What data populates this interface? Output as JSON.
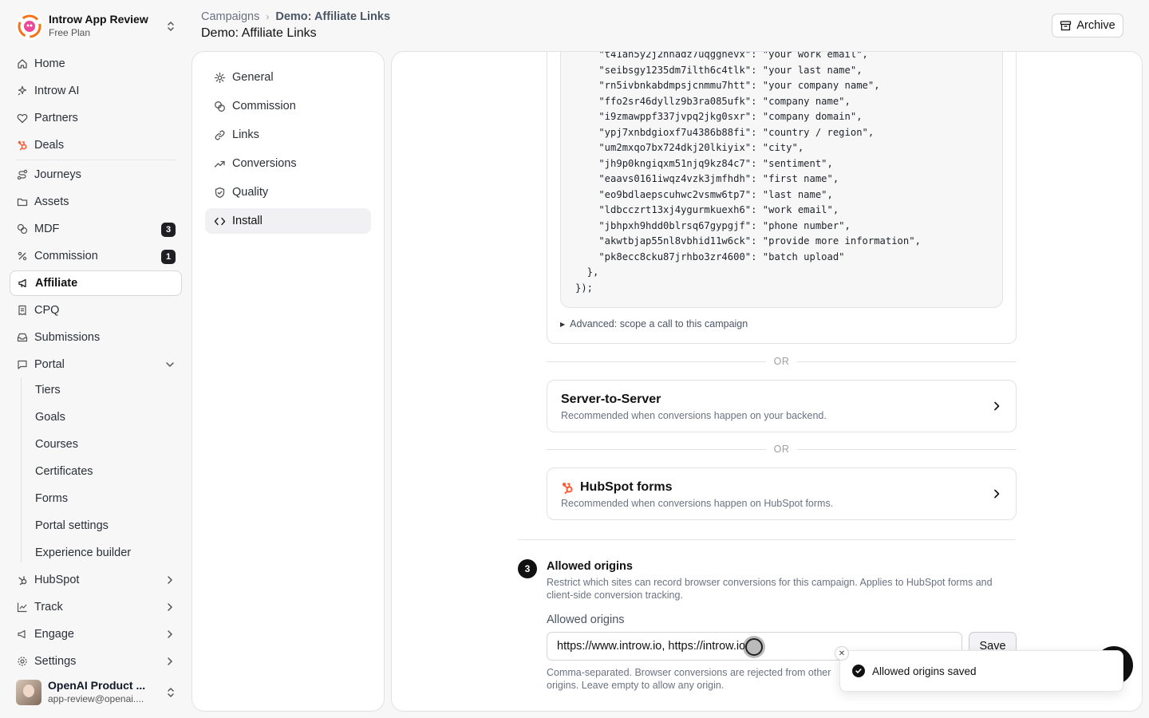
{
  "workspace": {
    "name": "Introw App Review",
    "plan": "Free Plan"
  },
  "nav": {
    "home": "Home",
    "introw_ai": "Introw AI",
    "partners": "Partners",
    "deals": "Deals",
    "journeys": "Journeys",
    "assets": "Assets",
    "mdf": "MDF",
    "mdf_badge": "3",
    "commission": "Commission",
    "commission_badge": "1",
    "affiliate": "Affiliate",
    "cpq": "CPQ",
    "submissions": "Submissions",
    "portal": "Portal",
    "portal_items": [
      "Tiers",
      "Goals",
      "Courses",
      "Certificates",
      "Forms",
      "Portal settings",
      "Experience builder"
    ],
    "hubspot": "HubSpot",
    "track": "Track",
    "engage": "Engage",
    "settings": "Settings"
  },
  "user": {
    "name": "OpenAI Product ...",
    "email": "app-review@openai...."
  },
  "header": {
    "breadcrumb_root": "Campaigns",
    "breadcrumb_current": "Demo: Affiliate Links",
    "title": "Demo: Affiliate Links",
    "archive_label": "Archive"
  },
  "settings_menu": [
    "General",
    "Commission",
    "Links",
    "Conversions",
    "Quality",
    "Install"
  ],
  "code_lines": [
    "    \"t41an5y2j2hnadz7uqgghevx\": \"your work email\",",
    "    \"seibsgy1235dm7ilth6c4tlk\": \"your last name\",",
    "    \"rn5ivbnkabdmpsjcnmmu7htt\": \"your company name\",",
    "    \"ffo2sr46dyllz9b3ra085ufk\": \"company name\",",
    "    \"i9zmawppf337jvpq2jkg0sxr\": \"company domain\",",
    "    \"ypj7xnbdgioxf7u4386b88fi\": \"country / region\",",
    "    \"um2mxqo7bx724dkj20lkiyix\": \"city\",",
    "    \"jh9p0kngiqxm51njq9kz84c7\": \"sentiment\",",
    "    \"eaavs0161iwqz4vzk3jmfhdh\": \"first name\",",
    "    \"eo9bdlaepscuhwc2vsmw6tp7\": \"last name\",",
    "    \"ldbcczrt13xj4ygurmkuexh6\": \"work email\",",
    "    \"jbhpxh9hdd0blrsq67gypgjf\": \"phone number\",",
    "    \"akwtbjap55nl8vbhid11w6ck\": \"provide more information\",",
    "    \"pk8ecc8cku87jrhbo3zr4600\": \"batch upload\"",
    "  },",
    "});"
  ],
  "advanced_label": "Advanced: scope a call to this campaign",
  "or_label": "OR",
  "server_card": {
    "title": "Server-to-Server",
    "desc": "Recommended when conversions happen on your backend."
  },
  "hubspot_card": {
    "title": "HubSpot forms",
    "desc": "Recommended when conversions happen on HubSpot forms."
  },
  "origins_section": {
    "step": "3",
    "title": "Allowed origins",
    "desc": "Restrict which sites can record browser conversions for this campaign. Applies to HubSpot forms and client-side conversion tracking.",
    "field_label": "Allowed origins",
    "value": "https://www.introw.io, https://introw.io",
    "save_label": "Save",
    "help": "Comma-separated. Browser conversions are rejected from other origins. Leave empty to allow any origin."
  },
  "toast": {
    "message": "Allowed origins saved"
  },
  "colors": {
    "hubspot": "#ff5c35",
    "logo_orange": "#f97316",
    "logo_pink": "#ec4899"
  }
}
